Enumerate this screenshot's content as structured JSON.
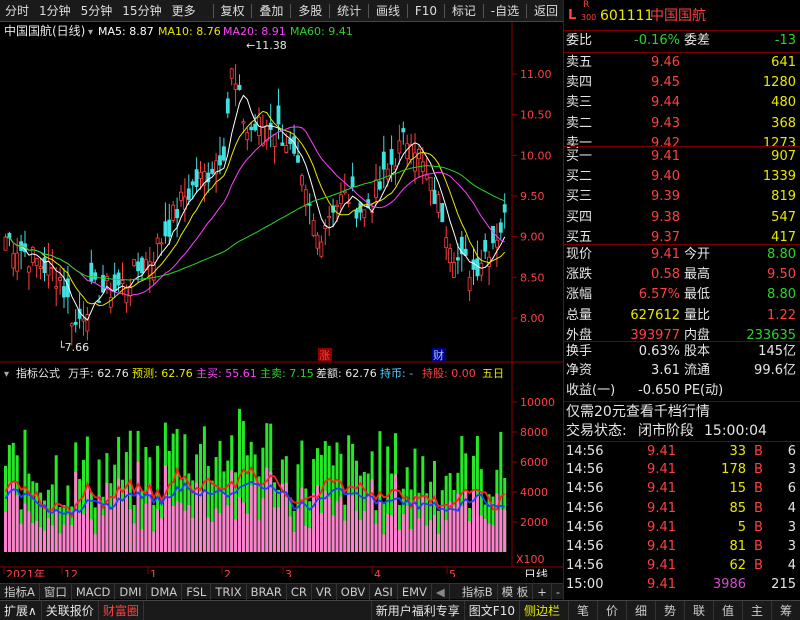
{
  "toolbar": {
    "left": [
      "分时",
      "1分钟",
      "5分钟",
      "15分钟",
      "更多"
    ],
    "right": [
      "复权",
      "叠加",
      "多股",
      "统计",
      "画线",
      "F10",
      "标记",
      "-自选",
      "返回"
    ]
  },
  "chart": {
    "title": "中国国航(日线)",
    "ma_labels": [
      {
        "text": "MA5: 8.87",
        "color": "#ffffff"
      },
      {
        "text": "MA10: 8.76",
        "color": "#e8e800"
      },
      {
        "text": "MA20: 8.91",
        "color": "#ff40ff"
      },
      {
        "text": "MA60: 9.41",
        "color": "#27d627"
      }
    ],
    "price_axis": [
      "11.00",
      "10.50",
      "10.00",
      "9.50",
      "9.00",
      "8.50",
      "8.00"
    ],
    "high_marker": "11.38",
    "low_marker": "7.66",
    "marks": [
      "涨",
      "财"
    ],
    "indicator_header": [
      {
        "text": "指标公式",
        "color": "#e6e6e6"
      },
      {
        "text": "万手: 62.76",
        "color": "#e6e6e6"
      },
      {
        "text": "预测: 62.76",
        "color": "#e8e800"
      },
      {
        "text": "主买: 55.61",
        "color": "#ff40ff"
      },
      {
        "text": "主卖: 7.15",
        "color": "#27d627"
      },
      {
        "text": "差额: 62.76",
        "color": "#e6e6e6"
      },
      {
        "text": "持币: -",
        "color": "#4fd0ff"
      },
      {
        "text": "持股: 0.00",
        "color": "#ff4040"
      },
      {
        "text": "五日",
        "color": "#e8e800"
      }
    ],
    "volume_axis": [
      "10000",
      "8000",
      "6000",
      "4000",
      "2000"
    ],
    "volume_unit": "X100",
    "date_labels": [
      "2021年",
      "12",
      "1",
      "2",
      "3",
      "4",
      "5"
    ],
    "period": "日线"
  },
  "tabs": [
    "指标A",
    "窗口",
    "MACD",
    "DMI",
    "DMA",
    "FSL",
    "TRIX",
    "BRAR",
    "CR",
    "VR",
    "OBV",
    "ASI",
    "EMV"
  ],
  "tabs_right": [
    "指标B",
    "模 板",
    "+",
    "-"
  ],
  "status": {
    "left": [
      "扩展∧",
      "关联报价",
      "财富圈"
    ],
    "middle": [
      "新用户福利专享",
      "图文F10",
      "侧边栏"
    ],
    "right": [
      "笔",
      "价",
      "细",
      "势",
      "联",
      "值",
      "主",
      "筹"
    ]
  },
  "quote": {
    "code": "601111",
    "name": "中国国航",
    "badge_l": "L",
    "badge_r": "R",
    "badge_n": "300",
    "weibi_label": "委比",
    "weibi": "-0.16%",
    "weicha_label": "委差",
    "weicha": "-13",
    "sell": [
      {
        "label": "卖五",
        "price": "9.46",
        "vol": "641"
      },
      {
        "label": "卖四",
        "price": "9.45",
        "vol": "1280"
      },
      {
        "label": "卖三",
        "price": "9.44",
        "vol": "480"
      },
      {
        "label": "卖二",
        "price": "9.43",
        "vol": "368"
      },
      {
        "label": "卖一",
        "price": "9.42",
        "vol": "1273"
      }
    ],
    "buy": [
      {
        "label": "买一",
        "price": "9.41",
        "vol": "907"
      },
      {
        "label": "买二",
        "price": "9.40",
        "vol": "1339"
      },
      {
        "label": "买三",
        "price": "9.39",
        "vol": "819"
      },
      {
        "label": "买四",
        "price": "9.38",
        "vol": "547"
      },
      {
        "label": "买五",
        "price": "9.37",
        "vol": "417"
      }
    ],
    "stats": [
      {
        "l1": "现价",
        "v1": "9.41",
        "c1": "r",
        "l2": "今开",
        "v2": "8.80",
        "c2": "g"
      },
      {
        "l1": "涨跌",
        "v1": "0.58",
        "c1": "r",
        "l2": "最高",
        "v2": "9.50",
        "c2": "r"
      },
      {
        "l1": "涨幅",
        "v1": "6.57%",
        "c1": "r",
        "l2": "最低",
        "v2": "8.80",
        "c2": "g"
      },
      {
        "l1": "总量",
        "v1": "627612",
        "c1": "y",
        "l2": "量比",
        "v2": "1.22",
        "c2": "r"
      },
      {
        "l1": "外盘",
        "v1": "393977",
        "c1": "r",
        "l2": "内盘",
        "v2": "233635",
        "c2": "g"
      }
    ],
    "fin": [
      {
        "l1": "换手",
        "v1": "0.63%",
        "l2": "股本",
        "v2": "145亿"
      },
      {
        "l1": "净资",
        "v1": "3.61",
        "l2": "流通",
        "v2": "99.6亿"
      },
      {
        "l1": "收益(一)",
        "v1": "-0.650",
        "l2": "PE(动)",
        "v2": ""
      }
    ],
    "promo": "仅需20元查看千档行情",
    "state_label": "交易状态:",
    "state": "闭市阶段",
    "state_time": "15:00:04",
    "ticks": [
      {
        "t": "14:56",
        "p": "9.41",
        "v": "33",
        "s": "B",
        "n": "6"
      },
      {
        "t": "14:56",
        "p": "9.41",
        "v": "178",
        "s": "B",
        "n": "3"
      },
      {
        "t": "14:56",
        "p": "9.41",
        "v": "15",
        "s": "B",
        "n": "6"
      },
      {
        "t": "14:56",
        "p": "9.41",
        "v": "85",
        "s": "B",
        "n": "4"
      },
      {
        "t": "14:56",
        "p": "9.41",
        "v": "5",
        "s": "B",
        "n": "3"
      },
      {
        "t": "14:56",
        "p": "9.41",
        "v": "81",
        "s": "B",
        "n": "3"
      },
      {
        "t": "14:56",
        "p": "9.41",
        "v": "62",
        "s": "B",
        "n": "4"
      },
      {
        "t": "15:00",
        "p": "9.41",
        "v": "3986",
        "s": "",
        "n": "215"
      }
    ]
  }
}
